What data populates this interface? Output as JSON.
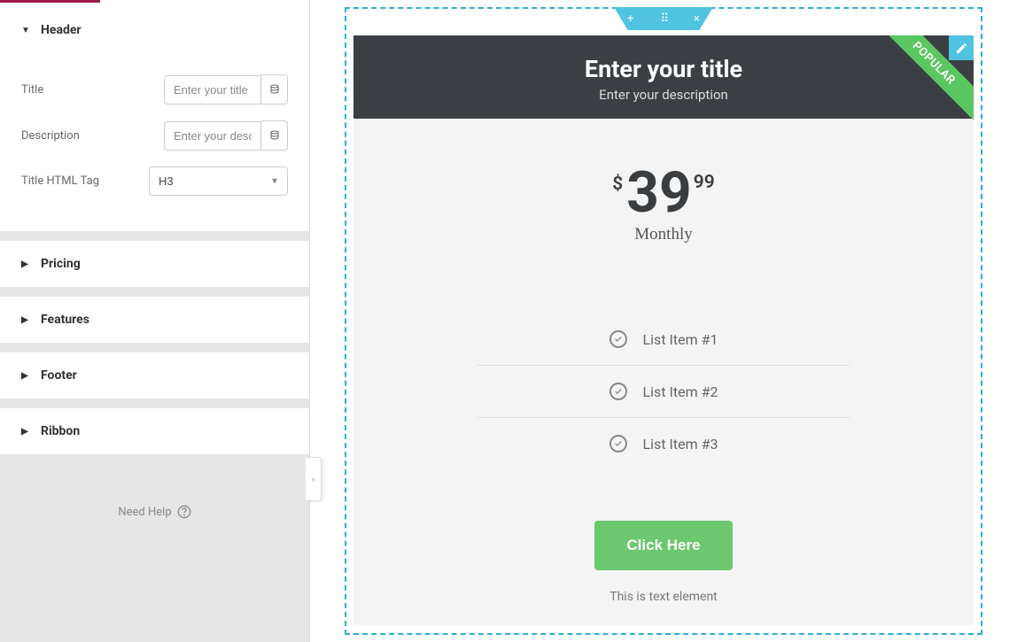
{
  "sidebar": {
    "sections": {
      "header": {
        "label": "Header",
        "expanded": true
      },
      "pricing": {
        "label": "Pricing"
      },
      "features": {
        "label": "Features"
      },
      "footer": {
        "label": "Footer"
      },
      "ribbon": {
        "label": "Ribbon"
      }
    },
    "fields": {
      "title": {
        "label": "Title",
        "placeholder": "Enter your title",
        "value": ""
      },
      "description": {
        "label": "Description",
        "placeholder": "Enter your description",
        "value": ""
      },
      "title_tag": {
        "label": "Title HTML Tag",
        "value": "H3"
      }
    },
    "need_help": "Need Help"
  },
  "canvas": {
    "toolbar": {
      "add": "+",
      "drag": "⋮⋮⋮",
      "close": "×"
    },
    "card": {
      "title": "Enter your title",
      "description": "Enter your description",
      "ribbon": "POPULAR",
      "currency": "$",
      "amount": "39",
      "frac": "99",
      "period": "Monthly",
      "features": [
        "List Item #1",
        "List Item #2",
        "List Item #3"
      ],
      "button": "Click Here",
      "footer_text": "This is text element"
    }
  }
}
